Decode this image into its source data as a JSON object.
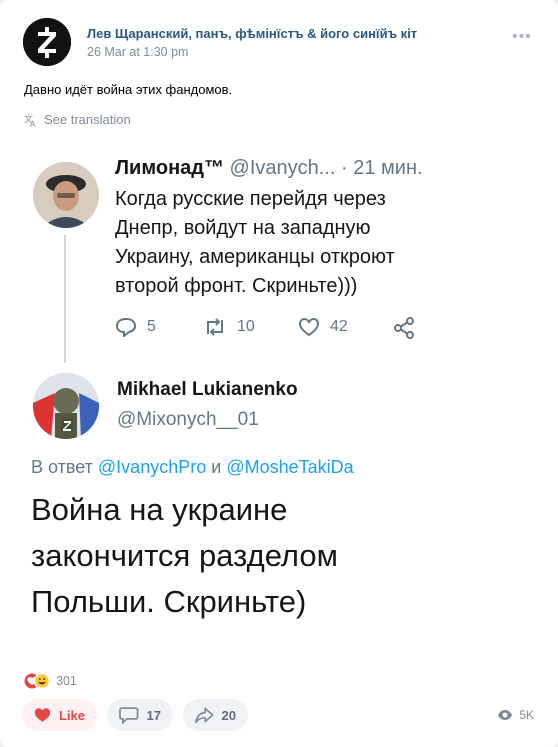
{
  "post": {
    "author": "Лев Щаранский, панъ, фѣмінїстъ & його синїйъ кіт",
    "time": "26 Mar at 1:30 pm",
    "text": "Давно идёт война этих фандомов.",
    "see_translation": "See translation",
    "more_icon": "more-dots-icon"
  },
  "screenshot": {
    "tweet1": {
      "name": "Лимонад™",
      "handle_time": "@Ivanych... · 21 мин.",
      "body": "Когда русские перейдя через Днепр, войдут на западную Украину, американцы откроют второй фронт. Скриньте)))",
      "replies": "5",
      "retweets": "10",
      "likes": "42"
    },
    "tweet2": {
      "name": "Mikhael Lukianenko",
      "handle": "@Mixonych__01",
      "reply_prefix": "В ответ",
      "reply_user1": "@IvanychPro",
      "reply_and": "и",
      "reply_user2": "@MosheTakiDa",
      "body": "Война на украине закончится разделом Польши. Скриньте)"
    }
  },
  "footer": {
    "reactions_count": "301",
    "like_label": "Like",
    "comments_count": "17",
    "shares_count": "20",
    "views": "5K"
  },
  "colors": {
    "link": "#2a5885",
    "like": "#e64646",
    "twitter_blue": "#1da1f2"
  }
}
